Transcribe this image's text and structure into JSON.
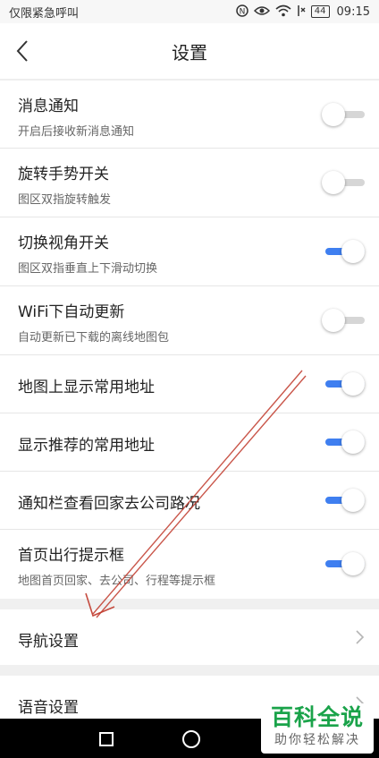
{
  "status_bar": {
    "carrier": "仅限紧急呼叫",
    "icons": [
      "nfc-icon",
      "eye-icon",
      "wifi-icon",
      "no-sim-icon"
    ],
    "battery": "44",
    "time": "09:15"
  },
  "header": {
    "title": "设置",
    "back_icon": "chevron-left-icon"
  },
  "settings": [
    {
      "title": "消息通知",
      "subtitle": "开启后接收新消息通知",
      "toggle_on": false
    },
    {
      "title": "旋转手势开关",
      "subtitle": "图区双指旋转触发",
      "toggle_on": false
    },
    {
      "title": "切换视角开关",
      "subtitle": "图区双指垂直上下滑动切换",
      "toggle_on": true
    },
    {
      "title": "WiFi下自动更新",
      "subtitle": "自动更新已下载的离线地图包",
      "toggle_on": false
    },
    {
      "title": "地图上显示常用地址",
      "toggle_on": true
    },
    {
      "title": "显示推荐的常用地址",
      "toggle_on": true
    },
    {
      "title": "通知栏查看回家去公司路况",
      "toggle_on": true
    },
    {
      "title": "首页出行提示框",
      "subtitle": "地图首页回家、去公司、行程等提示框",
      "toggle_on": true
    }
  ],
  "links": [
    {
      "title": "导航设置"
    },
    {
      "title": "语音设置"
    }
  ],
  "nav_bar": {
    "icons": [
      "recents-icon",
      "home-icon"
    ]
  },
  "watermark": {
    "title": "百科全说",
    "subtitle": "助你轻松解决"
  },
  "colors": {
    "accent": "#3f7ff0",
    "annotation_arrow": "#c0392b",
    "watermark_green": "#1aa34a"
  }
}
